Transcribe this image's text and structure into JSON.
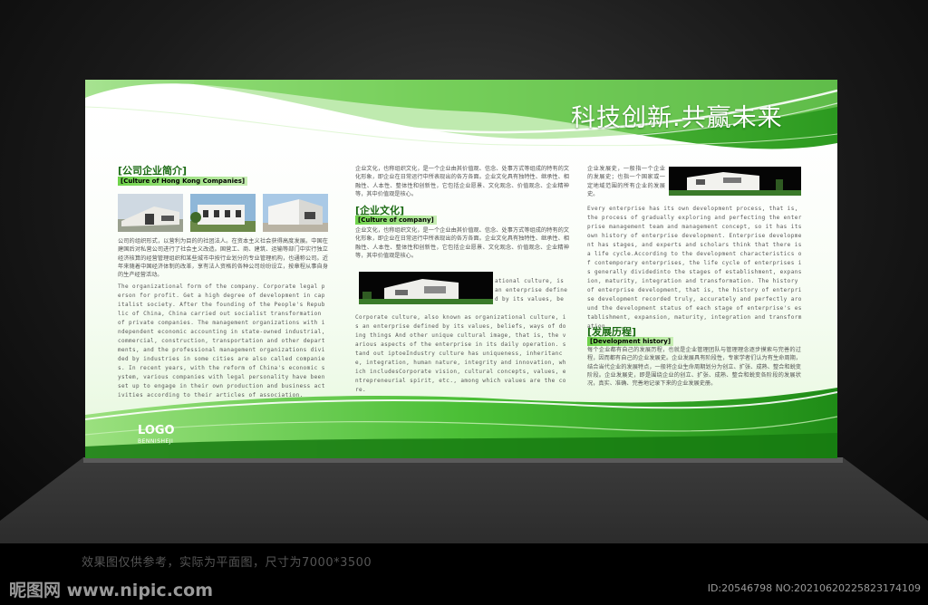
{
  "slogan": "科技创新.共赢未来",
  "colors": {
    "brand_green": "#3aa82a",
    "dark_green": "#1a6a12",
    "light_green": "#c8efb5"
  },
  "company_intro": {
    "title": "[公司企业简介]",
    "subtitle": "[Culture of Hong Kong Companies]",
    "zh_text": "公司的组织形式，以营利为目的的社团法人。在资本主义社会获得高度发展。中国在建国后对私营公司进行了社会主义改造。国营工、商、建筑、运输等部门中实行独立经济核算的经营管理组织和某些城市中按行业划分的专业管理机构，也通称公司。近年来随着中国经济体制的改革，享有法人资格的各种公司纷纷设立，按章程从事自身的生产经营活动。",
    "en_text": "The organizational form of the company. Corporate legal person for profit. Get a high degree of development in capitalist society. After the founding of the People's Republic of China, China carried out socialist transformation of private companies. The management organizations with independent economic accounting in state-owned industrial, commercial, construction, transportation and other departments, and the professional management organizations divided by industries in some cities are also called companies. In recent years, with the reform of China's economic system, various companies with legal personality have been set up to engage in their own production and business activities according to their articles of association."
  },
  "corporate_culture": {
    "intro_zh": "企业文化，也称组织文化，是一个企业由其价值观、信念、处事方式等组成的特有的文化形象，即企业在日常运行中所表现出的各方各面。企业文化具有独特性、继承性、相融性、人本性、整体性和创新性，它包括企业愿景、文化观念、价值观念、企业精神等，其中价值观是核心。",
    "title": "[企业文化]",
    "subtitle": "[Culture of company]",
    "zh_text": "企业文化，也称组织文化，是一个企业由其价值观、信念、处事方式等组成的特有的文化形象，即企业在日常运行中所表现出的各方各面。企业文化具有独特性、继承性、相融性、人本性、整体性和创新性，它包括企业愿景、文化观念、价值观念、企业精神等，其中价值观是核心。",
    "side_en": "ational culture, is an enterprise defined by its values, be",
    "en_text": "Corporate culture, also known as organizational culture, is an enterprise defined by its values, beliefs, ways of doing things And other unique cultural image, that is, the various aspects of the enterprise in its daily operation. stand out iptoeIndustry culture has uniqueness, inheritance, integration, human nature, integrity and innovation, which includesCorporate vision, cultural concepts, values, entrepreneurial spirit, etc., among which values are the core."
  },
  "development": {
    "intro_zh": "企业发展史，一般指一个企业的发展史；也指一个国家或一定地域范围的所有企业的发展史。",
    "en_text": "Every enterprise has its own development process, that is, the process of gradually exploring and perfecting the enterprise management team and management concept, so it has its own history of enterprise development. Enterprise development has stages, and experts and scholars think that there is a life cycle.According to the development characteristics of contemporary enterprises, the life cycle of enterprises is generally dividedinto the stages of establishment, expansion, maturity, integration and transformation. The history of enterprise development, that is, the history of enterprise development recorded truly, accurately and perfectly around the development status of each stage of enterprise's establishment, expansion, maturity, integration and transformation.",
    "title": "[发展历程]",
    "subtitle": "[Development history]",
    "zh_text": "每个企业都有自己的发展历程，也就是企业管理团队与管理理念逐步摸索与完善的过程，因而都有自己的企业发展史。企业发展具有阶段性，专家学者们认为有生命周期，结合当代企业的发展特点，一般将企业生命周期划分为创立、扩张、成熟、整合和蜕变阶段。企业发展史，即是围绕企业的创立、扩张、成熟、整合和蜕变各阶段的发展状况，真实、准确、完善地记录下来的企业发展史册。"
  },
  "logo": {
    "text": "LOGO",
    "sub": "BENNISHEJI"
  },
  "note": "效果图仅供参考，实际为平面图，尺寸为7000*3500",
  "watermark": {
    "site": "昵图网 www.nipic.com",
    "id": "ID:20546798 NO:20210620225823174109"
  }
}
